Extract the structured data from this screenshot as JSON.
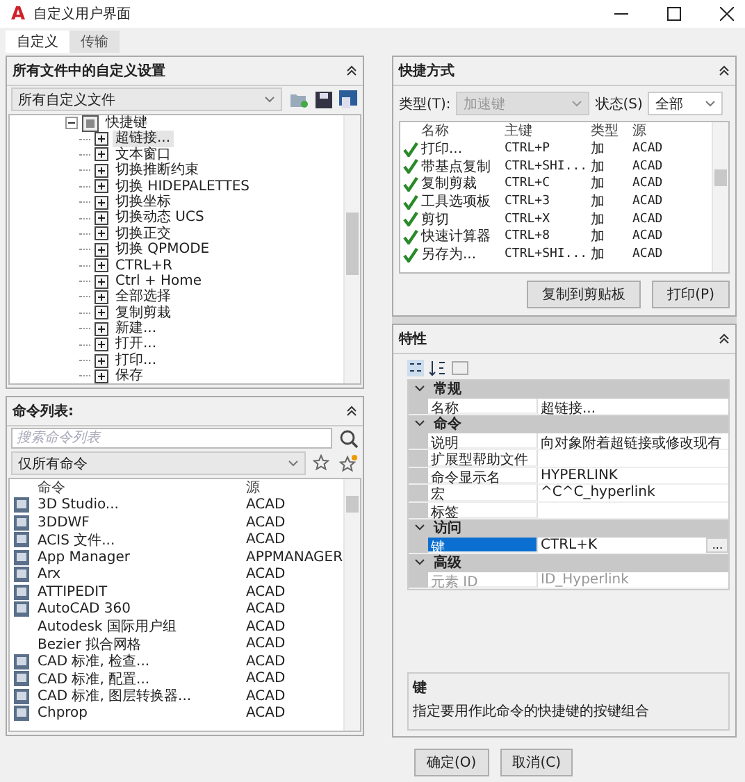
{
  "window": {
    "logo": "A",
    "title": "自定义用户界面"
  },
  "tabs": [
    {
      "label": "自定义",
      "selected": true
    },
    {
      "label": "传输",
      "selected": false
    }
  ],
  "customizations": {
    "title": "所有文件中的自定义设置",
    "file_select": "所有自定义文件",
    "tree": [
      {
        "label": "快捷键",
        "expanded": true,
        "children": [
          {
            "label": "超链接...",
            "expanded": false,
            "selected": true
          },
          {
            "label": "文本窗口",
            "expanded": false,
            "selected": false
          },
          {
            "label": "切换推断约束",
            "expanded": false,
            "selected": false
          },
          {
            "label": "切换 HIDEPALETTES",
            "expanded": false,
            "selected": false
          },
          {
            "label": "切换坐标",
            "expanded": false,
            "selected": false
          },
          {
            "label": "切换动态 UCS",
            "expanded": false,
            "selected": false
          },
          {
            "label": "切换正交",
            "expanded": false,
            "selected": false
          },
          {
            "label": "切换 QPMODE",
            "expanded": false,
            "selected": false
          },
          {
            "label": "CTRL+R",
            "expanded": false,
            "selected": false
          },
          {
            "label": "Ctrl + Home",
            "expanded": false,
            "selected": false
          },
          {
            "label": "全部选择",
            "expanded": false,
            "selected": false
          },
          {
            "label": "复制剪栽",
            "expanded": false,
            "selected": false
          },
          {
            "label": "新建...",
            "expanded": false,
            "selected": false
          },
          {
            "label": "打开...",
            "expanded": false,
            "selected": false
          },
          {
            "label": "打印...",
            "expanded": false,
            "selected": false
          },
          {
            "label": "保存",
            "expanded": false,
            "selected": false
          }
        ]
      }
    ]
  },
  "command_list": {
    "title": "命令列表:",
    "search": {
      "placeholder": "搜索命令列表"
    },
    "filter": "仅所有命令",
    "columns": [
      "命令",
      "源"
    ],
    "rows": [
      {
        "icon": true,
        "command": "3D Studio...",
        "source": "ACAD"
      },
      {
        "icon": true,
        "command": "3DDWF",
        "source": "ACAD"
      },
      {
        "icon": true,
        "command": "ACIS 文件...",
        "source": "ACAD"
      },
      {
        "icon": true,
        "command": "App Manager",
        "source": "APPMANAGER"
      },
      {
        "icon": true,
        "command": "Arx",
        "source": "ACAD"
      },
      {
        "icon": true,
        "command": "ATTIPEDIT",
        "source": "ACAD"
      },
      {
        "icon": true,
        "command": "AutoCAD 360",
        "source": "ACAD"
      },
      {
        "icon": false,
        "command": "Autodesk 国际用户组",
        "source": "ACAD"
      },
      {
        "icon": false,
        "command": "Bezier 拟合网格",
        "source": "ACAD"
      },
      {
        "icon": true,
        "command": "CAD 标准, 检查...",
        "source": "ACAD"
      },
      {
        "icon": true,
        "command": "CAD 标准, 配置...",
        "source": "ACAD"
      },
      {
        "icon": true,
        "command": "CAD 标准, 图层转换器...",
        "source": "ACAD"
      },
      {
        "icon": true,
        "command": "Chprop",
        "source": "ACAD"
      }
    ]
  },
  "shortcuts": {
    "title": "快捷方式",
    "type_label": "类型(T):",
    "type_value": "加速键",
    "type_disabled": true,
    "status_label": "状态(S)",
    "status_value": "全部",
    "columns": [
      "名称",
      "主键",
      "类型",
      "源"
    ],
    "rows": [
      {
        "checked": true,
        "name": "打印...",
        "key": "CTRL+P",
        "type": "加",
        "source": "ACAD"
      },
      {
        "checked": true,
        "name": "带基点复制",
        "key": "CTRL+SHI...",
        "type": "加",
        "source": "ACAD"
      },
      {
        "checked": true,
        "name": "复制剪裁",
        "key": "CTRL+C",
        "type": "加",
        "source": "ACAD"
      },
      {
        "checked": true,
        "name": "工具选项板",
        "key": "CTRL+3",
        "type": "加",
        "source": "ACAD"
      },
      {
        "checked": true,
        "name": "剪切",
        "key": "CTRL+X",
        "type": "加",
        "source": "ACAD"
      },
      {
        "checked": true,
        "name": "快速计算器",
        "key": "CTRL+8",
        "type": "加",
        "source": "ACAD"
      },
      {
        "checked": true,
        "name": "另存为...",
        "key": "CTRL+SHI...",
        "type": "加",
        "source": "ACAD"
      }
    ],
    "buttons": [
      "复制到剪贴板",
      "打印(P)"
    ]
  },
  "properties": {
    "title": "特性",
    "categories": [
      {
        "name": "常规",
        "expanded": true,
        "rows": [
          {
            "name": "名称",
            "value": "超链接...",
            "selected": false,
            "disabled": false
          }
        ]
      },
      {
        "name": "命令",
        "expanded": true,
        "rows": [
          {
            "name": "说明",
            "value": "向对象附着超链接或修改现有",
            "selected": false,
            "disabled": false
          },
          {
            "name": "扩展型帮助文件",
            "value": "",
            "selected": false,
            "disabled": false
          },
          {
            "name": "命令显示名",
            "value": "HYPERLINK",
            "selected": false,
            "disabled": false
          },
          {
            "name": "宏",
            "value": "^C^C_hyperlink",
            "selected": false,
            "disabled": false
          },
          {
            "name": "标签",
            "value": "",
            "selected": false,
            "disabled": false
          }
        ]
      },
      {
        "name": "访问",
        "expanded": true,
        "rows": [
          {
            "name": "键",
            "value": "CTRL+K",
            "selected": true,
            "disabled": false,
            "browse": "..."
          }
        ]
      },
      {
        "name": "高级",
        "expanded": true,
        "rows": [
          {
            "name": "元素 ID",
            "value": "ID_Hyperlink",
            "selected": false,
            "disabled": true
          }
        ]
      }
    ],
    "help_title": "键",
    "help_text": "指定要用作此命令的快捷键的按键组合"
  },
  "buttons": [
    "确定(O)",
    "取消(C)"
  ]
}
